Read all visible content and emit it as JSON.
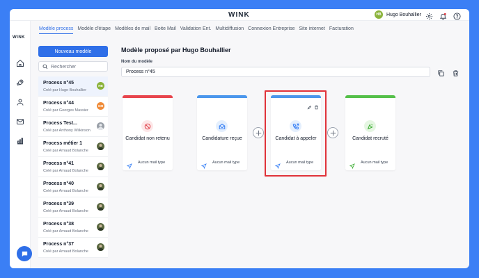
{
  "app": {
    "logo": "WINK",
    "rail_logo": "WINK"
  },
  "user": {
    "initials": "HB",
    "name": "Hugo Bouhallier"
  },
  "tabs": [
    {
      "label": "Modèle process",
      "active": true
    },
    {
      "label": "Modèle d'étape",
      "active": false
    },
    {
      "label": "Modèles de mail",
      "active": false
    },
    {
      "label": "Boite Mail",
      "active": false
    },
    {
      "label": "Validation Ent.",
      "active": false
    },
    {
      "label": "Multidiffusion",
      "active": false
    },
    {
      "label": "Connexion Entreprise",
      "active": false
    },
    {
      "label": "Site internet",
      "active": false
    },
    {
      "label": "Facturation",
      "active": false
    }
  ],
  "sidebar": {
    "new_button": "Nouveau modèle",
    "search_placeholder": "Rechercher",
    "items": [
      {
        "title": "Process n°45",
        "subtitle": "Créé par Hugo Bouhallier",
        "avatar": "HB",
        "avatar_color": "#8bb33b"
      },
      {
        "title": "Process n°44",
        "subtitle": "Créé par Georges Massier",
        "avatar": "GM",
        "avatar_color": "#f08c3a"
      },
      {
        "title": "Process Test...",
        "subtitle": "Créé par Anthony Wilkinson",
        "avatar": "",
        "avatar_color": "#6b7280"
      },
      {
        "title": "Process métier 1",
        "subtitle": "Créé par Arnaud Bolanche",
        "avatar": "",
        "avatar_color": "#4b5a3a"
      },
      {
        "title": "Process n°41",
        "subtitle": "Créé par Arnaud Bolanche",
        "avatar": "",
        "avatar_color": "#4b5a3a"
      },
      {
        "title": "Process n°40",
        "subtitle": "Créé par Arnaud Bolanche",
        "avatar": "",
        "avatar_color": "#4b5a3a"
      },
      {
        "title": "Process n°39",
        "subtitle": "Créé par Arnaud Bolanche",
        "avatar": "",
        "avatar_color": "#4b5a3a"
      },
      {
        "title": "Process n°38",
        "subtitle": "Créé par Arnaud Bolanche",
        "avatar": "",
        "avatar_color": "#4b5a3a"
      },
      {
        "title": "Process n°37",
        "subtitle": "Créé par Arnaud Bolanche",
        "avatar": "",
        "avatar_color": "#4b5a3a"
      }
    ]
  },
  "main": {
    "title": "Modèle proposé par Hugo Bouhallier",
    "field_label": "Nom du modèle",
    "model_name": "Process n°45"
  },
  "stages": [
    {
      "label": "Candidat non retenu",
      "bar_color": "#e8454d",
      "icon": "ban-icon",
      "icon_bg": "#fde7e8",
      "icon_color": "#e0454d",
      "mail": "Aucun mail type"
    },
    {
      "label": "Candidature reçue",
      "bar_color": "#4b97ec",
      "icon": "envelope-open-icon",
      "icon_bg": "#e4effd",
      "icon_color": "#3b82f6",
      "mail": "Aucun mail type"
    },
    {
      "label": "Candidat à appeler",
      "bar_color": "#4b97ec",
      "icon": "phone-icon",
      "icon_bg": "#e4effd",
      "icon_color": "#3b82f6",
      "mail": "Aucun mail type"
    },
    {
      "label": "Candidat recruté",
      "bar_color": "#55c04a",
      "icon": "party-icon",
      "icon_bg": "#e5f6e2",
      "icon_color": "#3fae35",
      "mail": "Aucun mail type"
    }
  ],
  "colors": {
    "accent": "#2f6fe8",
    "highlight": "#e0323a",
    "background": "#3b7ff5"
  }
}
